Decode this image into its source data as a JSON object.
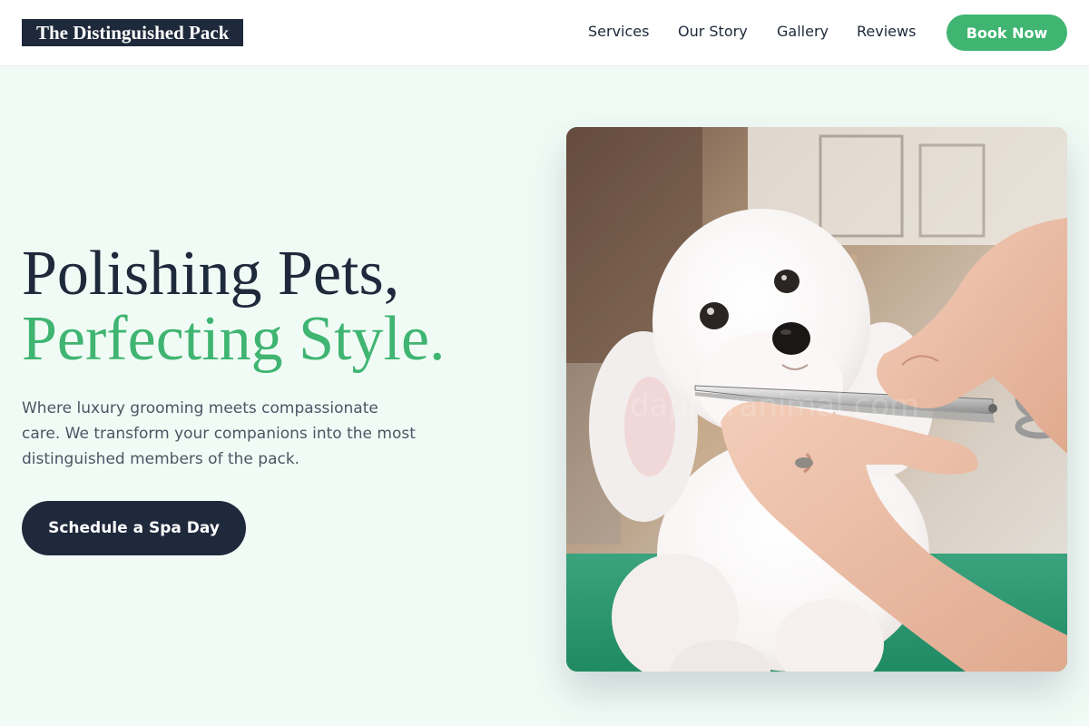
{
  "nav": {
    "logo": "The Distinguished Pack",
    "links": [
      "Services",
      "Our Story",
      "Gallery",
      "Reviews"
    ],
    "cta": "Book Now"
  },
  "hero": {
    "title_line1": "Polishing Pets,",
    "title_line2": "Perfecting Style.",
    "description": "Where luxury grooming meets compassionate care. We transform your companions into the most distinguished members of the pack.",
    "cta": "Schedule a Spa Day"
  },
  "image": {
    "subject": "white-poodle-grooming-photo",
    "watermark": "dapperanimal.com"
  },
  "colors": {
    "navy": "#1e293b",
    "green": "#3fb571",
    "background": "#f1fbf6",
    "text_muted": "#4b5563"
  }
}
